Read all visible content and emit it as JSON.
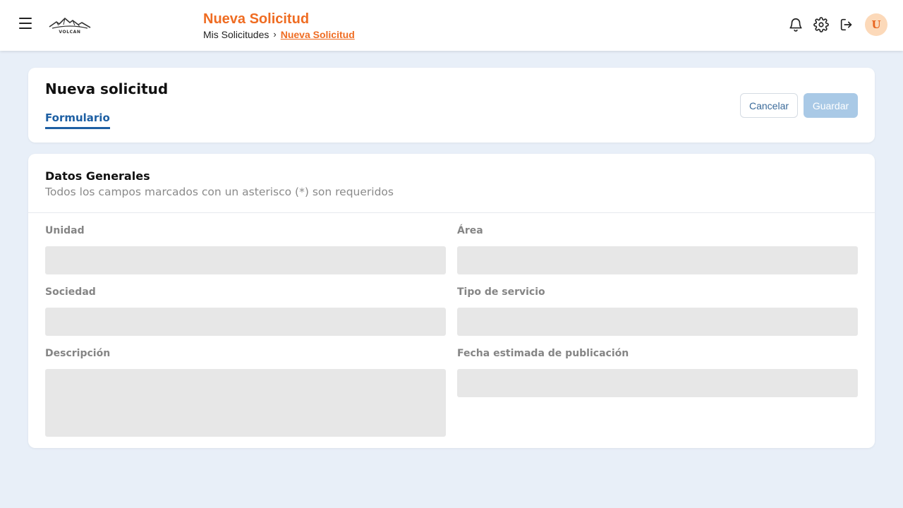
{
  "header": {
    "page_title": "Nueva Solicitud",
    "breadcrumb": {
      "root": "Mis Solicitudes",
      "separator": "›",
      "current": "Nueva Solicitud"
    },
    "avatar_initial": "U",
    "icons": [
      "menu-icon",
      "volcan-logo",
      "bell-icon",
      "gear-icon",
      "logout-icon"
    ]
  },
  "request": {
    "title": "Nueva solicitud",
    "tab": "Formulario",
    "cancel_label": "Cancelar",
    "save_label": "Guardar"
  },
  "form": {
    "section_title": "Datos Generales",
    "section_subtitle": "Todos los campos marcados con un asterisco (*) son requeridos",
    "fields": {
      "unidad": {
        "label": "Unidad",
        "value": ""
      },
      "area": {
        "label": "Área",
        "value": ""
      },
      "sociedad": {
        "label": "Sociedad",
        "value": ""
      },
      "tipo_servicio": {
        "label": "Tipo de servicio",
        "value": ""
      },
      "descripcion": {
        "label": "Descripción",
        "value": ""
      },
      "fecha_publicacion": {
        "label": "Fecha estimada de publicación",
        "value": ""
      }
    }
  },
  "colors": {
    "accent_orange": "#ef6c22",
    "primary_blue": "#1d5fa3",
    "save_disabled": "#a9c9e6",
    "background": "#e8eff8",
    "input_fill": "#e7e7e7"
  }
}
